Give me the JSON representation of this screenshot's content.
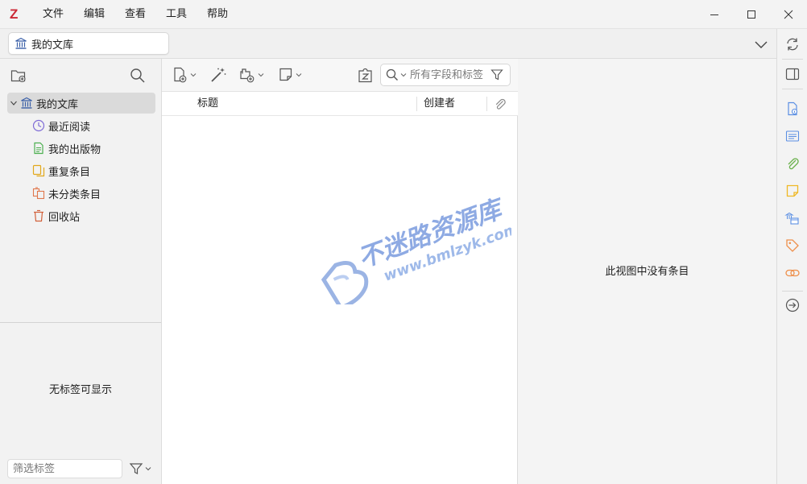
{
  "menu": {
    "logo": "Z",
    "items": [
      "文件",
      "编辑",
      "查看",
      "工具",
      "帮助"
    ]
  },
  "tab": {
    "label": "我的文库"
  },
  "collections": {
    "library_label": "我的文库",
    "items": [
      {
        "label": "最近阅读",
        "icon": "clock-icon"
      },
      {
        "label": "我的出版物",
        "icon": "publications-icon"
      },
      {
        "label": "重复条目",
        "icon": "duplicate-items-icon"
      },
      {
        "label": "未分类条目",
        "icon": "unfiled-items-icon"
      },
      {
        "label": "回收站",
        "icon": "trash-icon"
      }
    ]
  },
  "tags": {
    "empty_message": "无标签可显示",
    "filter_placeholder": "筛选标签"
  },
  "items": {
    "search_placeholder": "所有字段和标签",
    "columns": {
      "title": "标题",
      "creator": "创建者"
    }
  },
  "item_pane": {
    "empty_message": "此视图中没有条目"
  },
  "watermark": {
    "brand": "不迷路资源库",
    "url": "www.bmlzyk.com"
  },
  "colors": {
    "logo_red": "#cc2936",
    "library_blue": "#3a5fa8",
    "clock_purple": "#7f6cd6",
    "publications_green": "#4caf50",
    "duplicate_yellow": "#e2a81b",
    "unfiled_orange": "#e0774c",
    "trash_red": "#d2603a",
    "sidenav_blue": "#5b8fe3",
    "sidenav_green": "#6ab04c",
    "sidenav_yellow": "#efb824",
    "sidenav_orange": "#ee8f4a"
  }
}
